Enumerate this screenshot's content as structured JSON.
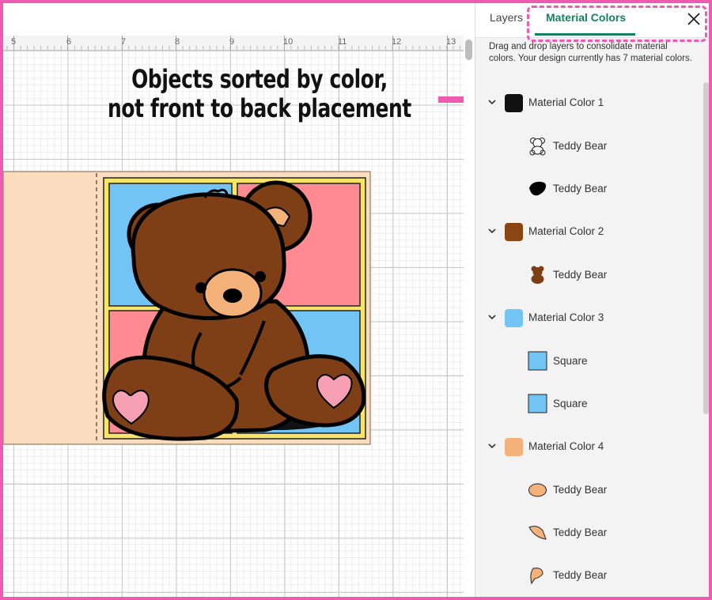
{
  "annotation": {
    "line1": "Objects sorted by color,",
    "line2": "not front to back placement"
  },
  "ruler": {
    "labels": [
      "5",
      "6",
      "7",
      "8",
      "9",
      "10",
      "11",
      "12",
      "13"
    ]
  },
  "panel": {
    "tabs": [
      {
        "label": "Layers",
        "active": false
      },
      {
        "label": "Material Colors",
        "active": true
      }
    ],
    "help_text": "Drag and drop layers to consolidate material colors. Your design currently has 7 material colors.",
    "groups": [
      {
        "label": "Material Color 1",
        "color": "#111111",
        "layers": [
          {
            "label": "Teddy Bear",
            "icon": "bear-outline-icon"
          },
          {
            "label": "Teddy Bear",
            "icon": "bear-shadow-icon"
          }
        ]
      },
      {
        "label": "Material Color 2",
        "color": "#8b4513",
        "layers": [
          {
            "label": "Teddy Bear",
            "icon": "bear-body-icon"
          }
        ]
      },
      {
        "label": "Material Color 3",
        "color": "#72c4f5",
        "layers": [
          {
            "label": "Square",
            "icon": "square-icon"
          },
          {
            "label": "Square",
            "icon": "square-icon"
          }
        ]
      },
      {
        "label": "Material Color 4",
        "color": "#f4b27a",
        "layers": [
          {
            "label": "Teddy Bear",
            "icon": "bear-muzzle-icon"
          },
          {
            "label": "Teddy Bear",
            "icon": "bear-ear-icon"
          },
          {
            "label": "Teddy Bear",
            "icon": "bear-ear-icon"
          }
        ]
      }
    ]
  },
  "colors": {
    "accent": "#18805a",
    "highlight": "#ee5bb0",
    "design_bg": "#fbdcbe",
    "blue": "#72c4f5",
    "pink": "#ff8a91",
    "yellow": "#f7e46a",
    "brown": "#8b4513",
    "tan": "#f4b27a"
  }
}
